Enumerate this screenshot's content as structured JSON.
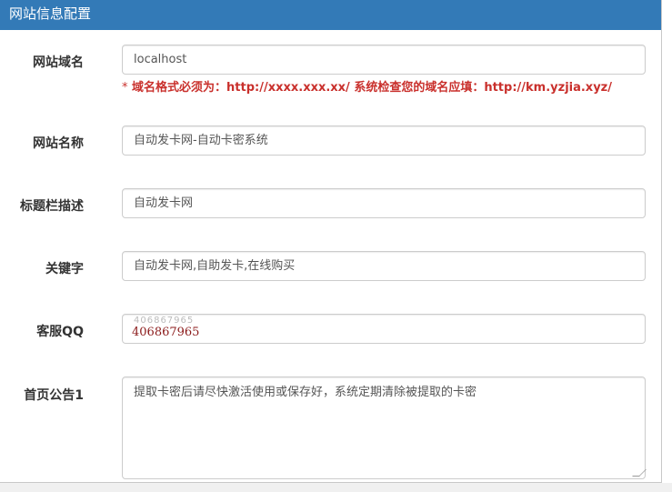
{
  "panel": {
    "title": "网站信息配置"
  },
  "fields": [
    {
      "label": "网站域名",
      "value": "localhost"
    },
    {
      "label": "网站名称",
      "value": "自动发卡网-自动卡密系统"
    },
    {
      "label": "标题栏描述",
      "value": "自动发卡网"
    },
    {
      "label": "关键字",
      "value": "自动发卡网,自助发卡,在线购买"
    },
    {
      "label": "客服QQ",
      "value": "406867965",
      "ghost": "406867965"
    },
    {
      "label": "首页公告1",
      "value": "提取卡密后请尽快激活使用或保存好，系统定期清除被提取的卡密"
    }
  ],
  "domain_help": {
    "star": "*",
    "text": "域名格式必须为：http://xxxx.xxx.xx/ 系统检查您的域名应填：http://km.yzjia.xyz/"
  },
  "colors": {
    "header": "#337ab7",
    "help": "#c9302c"
  }
}
